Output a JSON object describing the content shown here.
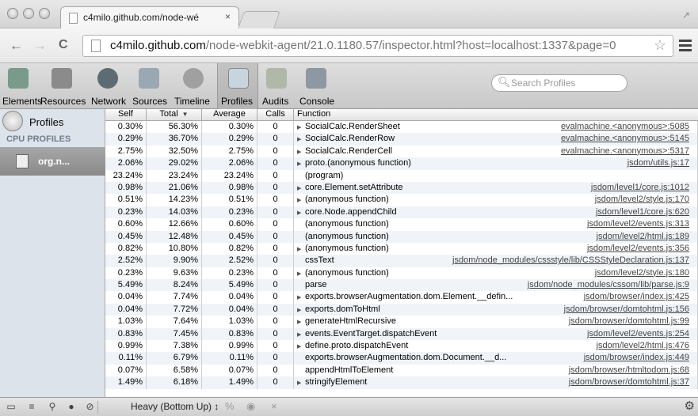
{
  "browser": {
    "tab_title": "c4milo.github.com/node-wé",
    "tab_close": "×",
    "url_host": "c4milo.github.com",
    "url_rest": "/node-webkit-agent/21.0.1180.57/inspector.html?host=localhost:1337&page=0",
    "back": "←",
    "forward": "→",
    "reload": "C",
    "star": "☆"
  },
  "devtools": {
    "panels": [
      {
        "label": "Elements",
        "color": "#7a9a8c"
      },
      {
        "label": "Resources",
        "color": "#8b8b8b"
      },
      {
        "label": "Network",
        "color": "#5d6b73"
      },
      {
        "label": "Sources",
        "color": "#9aa8b3"
      },
      {
        "label": "Timeline",
        "color": "#a0a0a0"
      },
      {
        "label": "Profiles",
        "color": "#c9d5de"
      },
      {
        "label": "Audits",
        "color": "#b0b8a8"
      },
      {
        "label": "Console",
        "color": "#8e98a3"
      }
    ],
    "search_placeholder": "Search Profiles"
  },
  "sidebar": {
    "profiles_label": "Profiles",
    "cpu_heading": "CPU PROFILES",
    "profile_item": "org.n..."
  },
  "grid": {
    "headers": {
      "self": "Self",
      "total": "Total",
      "average": "Average",
      "calls": "Calls",
      "function": "Function"
    },
    "sort_indicator": "▼",
    "rows": [
      {
        "self": "0.30%",
        "total": "56.30%",
        "avg": "0.30%",
        "calls": "0",
        "expand": true,
        "fn": "SocialCalc.RenderSheet",
        "url": "evalmachine.<anonymous>:5085"
      },
      {
        "self": "0.29%",
        "total": "36.70%",
        "avg": "0.29%",
        "calls": "0",
        "expand": true,
        "fn": "SocialCalc.RenderRow",
        "url": "evalmachine.<anonymous>:5145"
      },
      {
        "self": "2.75%",
        "total": "32.50%",
        "avg": "2.75%",
        "calls": "0",
        "expand": true,
        "fn": "SocialCalc.RenderCell",
        "url": "evalmachine.<anonymous>:5317"
      },
      {
        "self": "2.06%",
        "total": "29.02%",
        "avg": "2.06%",
        "calls": "0",
        "expand": true,
        "fn": "proto.(anonymous function)",
        "url": "jsdom/utils.js:17"
      },
      {
        "self": "23.24%",
        "total": "23.24%",
        "avg": "23.24%",
        "calls": "0",
        "expand": false,
        "fn": "(program)",
        "url": ""
      },
      {
        "self": "0.98%",
        "total": "21.06%",
        "avg": "0.98%",
        "calls": "0",
        "expand": true,
        "fn": "core.Element.setAttribute",
        "url": "jsdom/level1/core.js:1012"
      },
      {
        "self": "0.51%",
        "total": "14.23%",
        "avg": "0.51%",
        "calls": "0",
        "expand": true,
        "fn": "(anonymous function)",
        "url": "jsdom/level2/style.js:170"
      },
      {
        "self": "0.23%",
        "total": "14.03%",
        "avg": "0.23%",
        "calls": "0",
        "expand": true,
        "fn": "core.Node.appendChild",
        "url": "jsdom/level1/core.js:620"
      },
      {
        "self": "0.60%",
        "total": "12.66%",
        "avg": "0.60%",
        "calls": "0",
        "expand": false,
        "fn": "(anonymous function)",
        "url": "jsdom/level2/events.js:313"
      },
      {
        "self": "0.45%",
        "total": "12.48%",
        "avg": "0.45%",
        "calls": "0",
        "expand": false,
        "fn": "(anonymous function)",
        "url": "jsdom/level2/html.js:189"
      },
      {
        "self": "0.82%",
        "total": "10.80%",
        "avg": "0.82%",
        "calls": "0",
        "expand": true,
        "fn": "(anonymous function)",
        "url": "jsdom/level2/events.js:356"
      },
      {
        "self": "2.52%",
        "total": "9.90%",
        "avg": "2.52%",
        "calls": "0",
        "expand": false,
        "fn": "cssText",
        "url": "jsdom/node_modules/cssstyle/lib/CSSStyleDeclaration.js:137"
      },
      {
        "self": "0.23%",
        "total": "9.63%",
        "avg": "0.23%",
        "calls": "0",
        "expand": true,
        "fn": "(anonymous function)",
        "url": "jsdom/level2/style.js:180"
      },
      {
        "self": "5.49%",
        "total": "8.24%",
        "avg": "5.49%",
        "calls": "0",
        "expand": false,
        "fn": "parse",
        "url": "jsdom/node_modules/cssom/lib/parse.js:9"
      },
      {
        "self": "0.04%",
        "total": "7.74%",
        "avg": "0.04%",
        "calls": "0",
        "expand": true,
        "fn": "exports.browserAugmentation.dom.Element.__defin...",
        "url": "jsdom/browser/index.js:425"
      },
      {
        "self": "0.04%",
        "total": "7.72%",
        "avg": "0.04%",
        "calls": "0",
        "expand": true,
        "fn": "exports.domToHtml",
        "url": "jsdom/browser/domtohtml.js:156"
      },
      {
        "self": "1.03%",
        "total": "7.64%",
        "avg": "1.03%",
        "calls": "0",
        "expand": true,
        "fn": "generateHtmlRecursive",
        "url": "jsdom/browser/domtohtml.js:99"
      },
      {
        "self": "0.83%",
        "total": "7.45%",
        "avg": "0.83%",
        "calls": "0",
        "expand": true,
        "fn": "events.EventTarget.dispatchEvent",
        "url": "jsdom/level2/events.js:254"
      },
      {
        "self": "0.99%",
        "total": "7.38%",
        "avg": "0.99%",
        "calls": "0",
        "expand": true,
        "fn": "define.proto.dispatchEvent",
        "url": "jsdom/level2/html.js:476"
      },
      {
        "self": "0.11%",
        "total": "6.79%",
        "avg": "0.11%",
        "calls": "0",
        "expand": false,
        "fn": "exports.browserAugmentation.dom.Document.__d...",
        "url": "jsdom/browser/index.js:449"
      },
      {
        "self": "0.07%",
        "total": "6.58%",
        "avg": "0.07%",
        "calls": "0",
        "expand": false,
        "fn": "appendHtmlToElement",
        "url": "jsdom/browser/htmltodom.js:68"
      },
      {
        "self": "1.49%",
        "total": "6.18%",
        "avg": "1.49%",
        "calls": "0",
        "expand": true,
        "fn": "stringifyElement",
        "url": "jsdom/browser/domtohtml.js:37"
      }
    ]
  },
  "statusbar": {
    "view_mode": "Heavy (Bottom Up) ↕",
    "percent": "%",
    "eye": "◉",
    "clear": "×",
    "gear": "⚙"
  }
}
